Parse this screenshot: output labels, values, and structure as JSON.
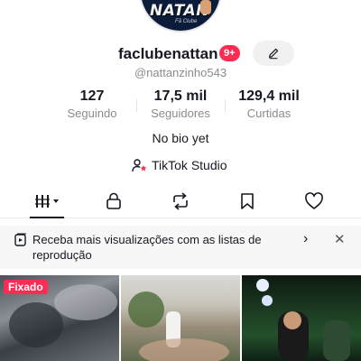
{
  "profile": {
    "avatar_text": "NATAN",
    "avatar_subtext": "Fã Clube",
    "username": "faclubenattan",
    "notification_badge": "9+",
    "handle": "@nattanzinho543",
    "bio": "No bio yet"
  },
  "stats": [
    {
      "value": "127",
      "label": "Seguindo"
    },
    {
      "value": "17,5 mil",
      "label": "Seguidores"
    },
    {
      "value": "129,4 mil",
      "label": "Curtidas"
    }
  ],
  "studio": {
    "label": "TikTok Studio",
    "icon": "person-star-icon"
  },
  "tabs": [
    {
      "name": "videos",
      "icon": "grid-bars-icon",
      "active": true
    },
    {
      "name": "private",
      "icon": "lock-icon",
      "active": false
    },
    {
      "name": "reposts",
      "icon": "repost-icon",
      "active": false
    },
    {
      "name": "favorites",
      "icon": "bookmark-icon",
      "active": false
    },
    {
      "name": "liked",
      "icon": "heart-icon",
      "active": false
    }
  ],
  "banner": {
    "text": "Receba mais visualizações com as listas de reprodução",
    "icon": "playlist-icon"
  },
  "videos": [
    {
      "badge": "Fixado"
    },
    {
      "badge": ""
    },
    {
      "badge": ""
    }
  ],
  "colors": {
    "accent": "#fe2c55",
    "text": "#161823",
    "muted": "#8a8b91",
    "banner_bg": "#f7f7f8"
  }
}
